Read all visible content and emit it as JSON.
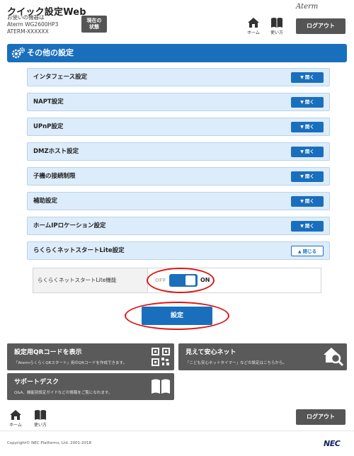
{
  "header": {
    "app_title": "クイック設定Web",
    "device_line1": "お使いの機器は",
    "device_line2": "Aterm WG2600HP3",
    "device_line3": "ATERM-XXXXXX",
    "status_button_line1": "現在の",
    "status_button_line2": "状態",
    "brand": "Aterm",
    "home_label": "ホーム",
    "guide_label": "使い方",
    "logout_label": "ログアウト"
  },
  "section": {
    "title": "その他の設定"
  },
  "accordion": [
    {
      "label": "インタフェース設定",
      "button": "開く",
      "state": "open-able"
    },
    {
      "label": "NAPT設定",
      "button": "開く",
      "state": "open-able"
    },
    {
      "label": "UPnP設定",
      "button": "開く",
      "state": "open-able"
    },
    {
      "label": "DMZホスト設定",
      "button": "開く",
      "state": "open-able"
    },
    {
      "label": "子機の接続制限",
      "button": "開く",
      "state": "open-able"
    },
    {
      "label": "補助設定",
      "button": "開く",
      "state": "open-able"
    },
    {
      "label": "ホームIPロケーション設定",
      "button": "開く",
      "state": "open-able"
    },
    {
      "label": "らくらくネットスタートLite設定",
      "button": "閉じる",
      "state": "expanded"
    }
  ],
  "lite_setting": {
    "label": "らくらくネットスタートLite機能",
    "off_label": "OFF",
    "on_label": "ON",
    "value": "ON"
  },
  "apply_button": "設定",
  "cards": {
    "qr": {
      "title": "設定用QRコードを表示",
      "subtitle": "「AtermらくらくQRスタート」用のQRコードを作成できます。",
      "icon": "qr-code-icon"
    },
    "safety": {
      "title": "見えて安心ネット",
      "subtitle": "「こども安心ネットタイマー」などの設定はこちらから。",
      "icon": "home-search-icon"
    },
    "support": {
      "title": "サポートデスク",
      "subtitle": "Q&A、機能別設定ガイドなどの情報をご覧になれます。",
      "icon": "book-icon"
    }
  },
  "footer": {
    "home_label": "ホーム",
    "guide_label": "使い方",
    "logout_label": "ログアウト",
    "copyright": "Copyright© NEC Platforms, Ltd. 2001-2018",
    "brand": "NEC"
  },
  "colors": {
    "accent_blue": "#1a6fbd",
    "row_bg": "#dcecfa",
    "dark_button": "#555555",
    "highlight_red": "#e01414"
  }
}
